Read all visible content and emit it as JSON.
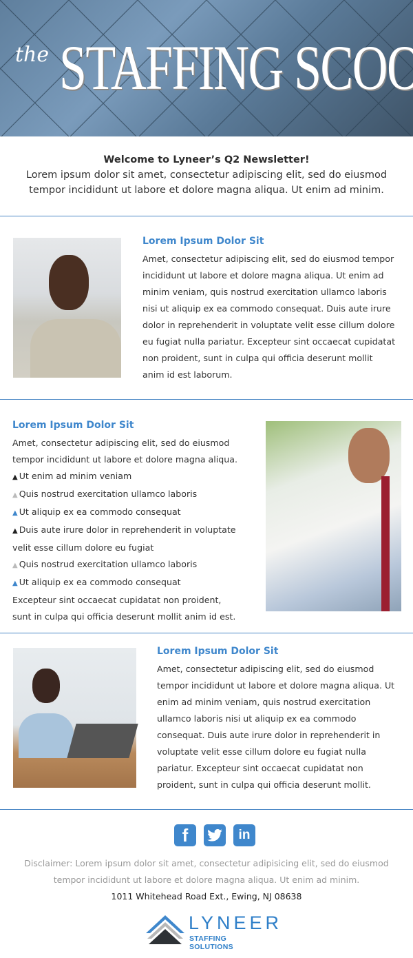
{
  "banner": {
    "the": "the",
    "title": "STAFFING SCOOP"
  },
  "intro": {
    "title": "Welcome to Lyneer’s Q2 Newsletter!",
    "line1": "Lorem ipsum dolor sit amet, consectetur adipiscing elit, sed do eiusmod",
    "line2": "tempor incididunt ut labore et dolore magna aliqua. Ut enim ad minim."
  },
  "sections": [
    {
      "heading": "Lorem Ipsum Dolor Sit",
      "lines": [
        "Amet, consectetur adipiscing elit, sed do eiusmod tempor",
        "incididunt ut labore et dolore magna aliqua. Ut enim ad",
        "minim veniam, quis nostrud exercitation ullamco laboris",
        "nisi ut aliquip ex ea commodo consequat. Duis aute irure",
        "dolor in reprehenderit in voluptate velit esse cillum dolore",
        "eu fugiat nulla pariatur. Excepteur sint occaecat cupidatat",
        "non proident, sunt in culpa qui officia deserunt mollit",
        "anim id est laborum."
      ]
    },
    {
      "heading": "Lorem Ipsum Dolor Sit",
      "intro": [
        "Amet, consectetur adipiscing elit, sed do eiusmod",
        "tempor incididunt ut labore et dolore magna aliqua."
      ],
      "bullets": [
        {
          "text": "Ut enim ad minim veniam",
          "color": "#222222"
        },
        {
          "text": "Quis nostrud exercitation ullamco laboris",
          "color": "#bbbbbb"
        },
        {
          "text": "Ut aliquip ex ea commodo consequat",
          "color": "#3f87cc"
        },
        {
          "text": "Duis aute irure dolor in reprehenderit in voluptate",
          "cont": "velit esse cillum dolore eu fugiat",
          "color": "#222222"
        },
        {
          "text": "Quis nostrud exercitation ullamco laboris",
          "color": "#bbbbbb"
        },
        {
          "text": "Ut aliquip ex ea commodo consequat",
          "color": "#3f87cc"
        }
      ],
      "outro": [
        "Excepteur sint occaecat cupidatat non proident,",
        "sunt in culpa qui officia deserunt mollit anim id est."
      ]
    },
    {
      "heading": "Lorem Ipsum Dolor Sit",
      "lines": [
        "Amet, consectetur adipiscing elit, sed do eiusmod",
        "tempor incididunt ut labore et dolore magna aliqua. Ut",
        "enim ad minim veniam, quis nostrud exercitation",
        "ullamco laboris nisi ut aliquip ex ea commodo",
        "consequat. Duis aute irure dolor in reprehenderit in",
        "voluptate velit esse cillum dolore eu fugiat nulla",
        "pariatur. Excepteur sint occaecat cupidatat non",
        "proident, sunt in culpa qui officia deserunt mollit."
      ]
    }
  ],
  "footer": {
    "social": [
      "facebook-icon",
      "twitter-icon",
      "linkedin-icon"
    ],
    "disclaimer1": "Disclaimer: Lorem ipsum dolor sit amet, consectetur adipisicing elit, sed do eiusmod",
    "disclaimer2": "tempor incididunt ut labore et dolore magna aliqua. Ut enim ad minim.",
    "address": "1011 Whitehead Road Ext., Ewing, NJ 08638",
    "logo_name": "LYNEER",
    "logo_sub": "STAFFING SOLUTIONS"
  },
  "colors": {
    "accent": "#3f87cc",
    "divider": "#4a87c5"
  }
}
